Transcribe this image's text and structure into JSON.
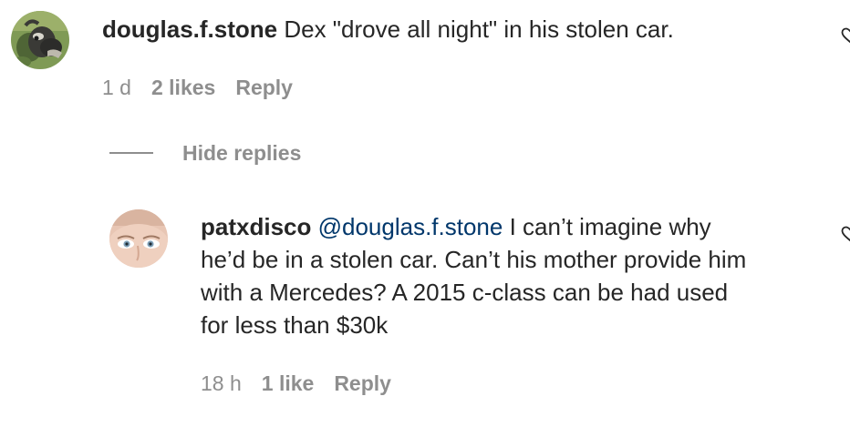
{
  "comments": [
    {
      "username": "douglas.f.stone",
      "text": " Dex \"drove all night\" in his stolen car.",
      "time": "1 d",
      "likes": "2 likes",
      "reply_label": "Reply",
      "icons": {
        "avatar": "avatar-goat-image",
        "like": "heart-icon"
      }
    }
  ],
  "hide_replies_label": "Hide replies",
  "replies": [
    {
      "username": "patxdisco",
      "mention": "@douglas.f.stone",
      "text_line1": " I can’t imagine why",
      "text_line2": "he’d be in a stolen car. Can’t his mother provide him",
      "text_line3": "with a Mercedes? A 2015 c-class can be had used",
      "text_line4": "for less than $30k",
      "time": "18 h",
      "likes": "1 like",
      "reply_label": "Reply",
      "icons": {
        "avatar": "avatar-face-image",
        "like": "heart-icon"
      }
    }
  ],
  "colors": {
    "text": "#262626",
    "secondary": "#8e8e8e",
    "mention": "#00376b"
  }
}
